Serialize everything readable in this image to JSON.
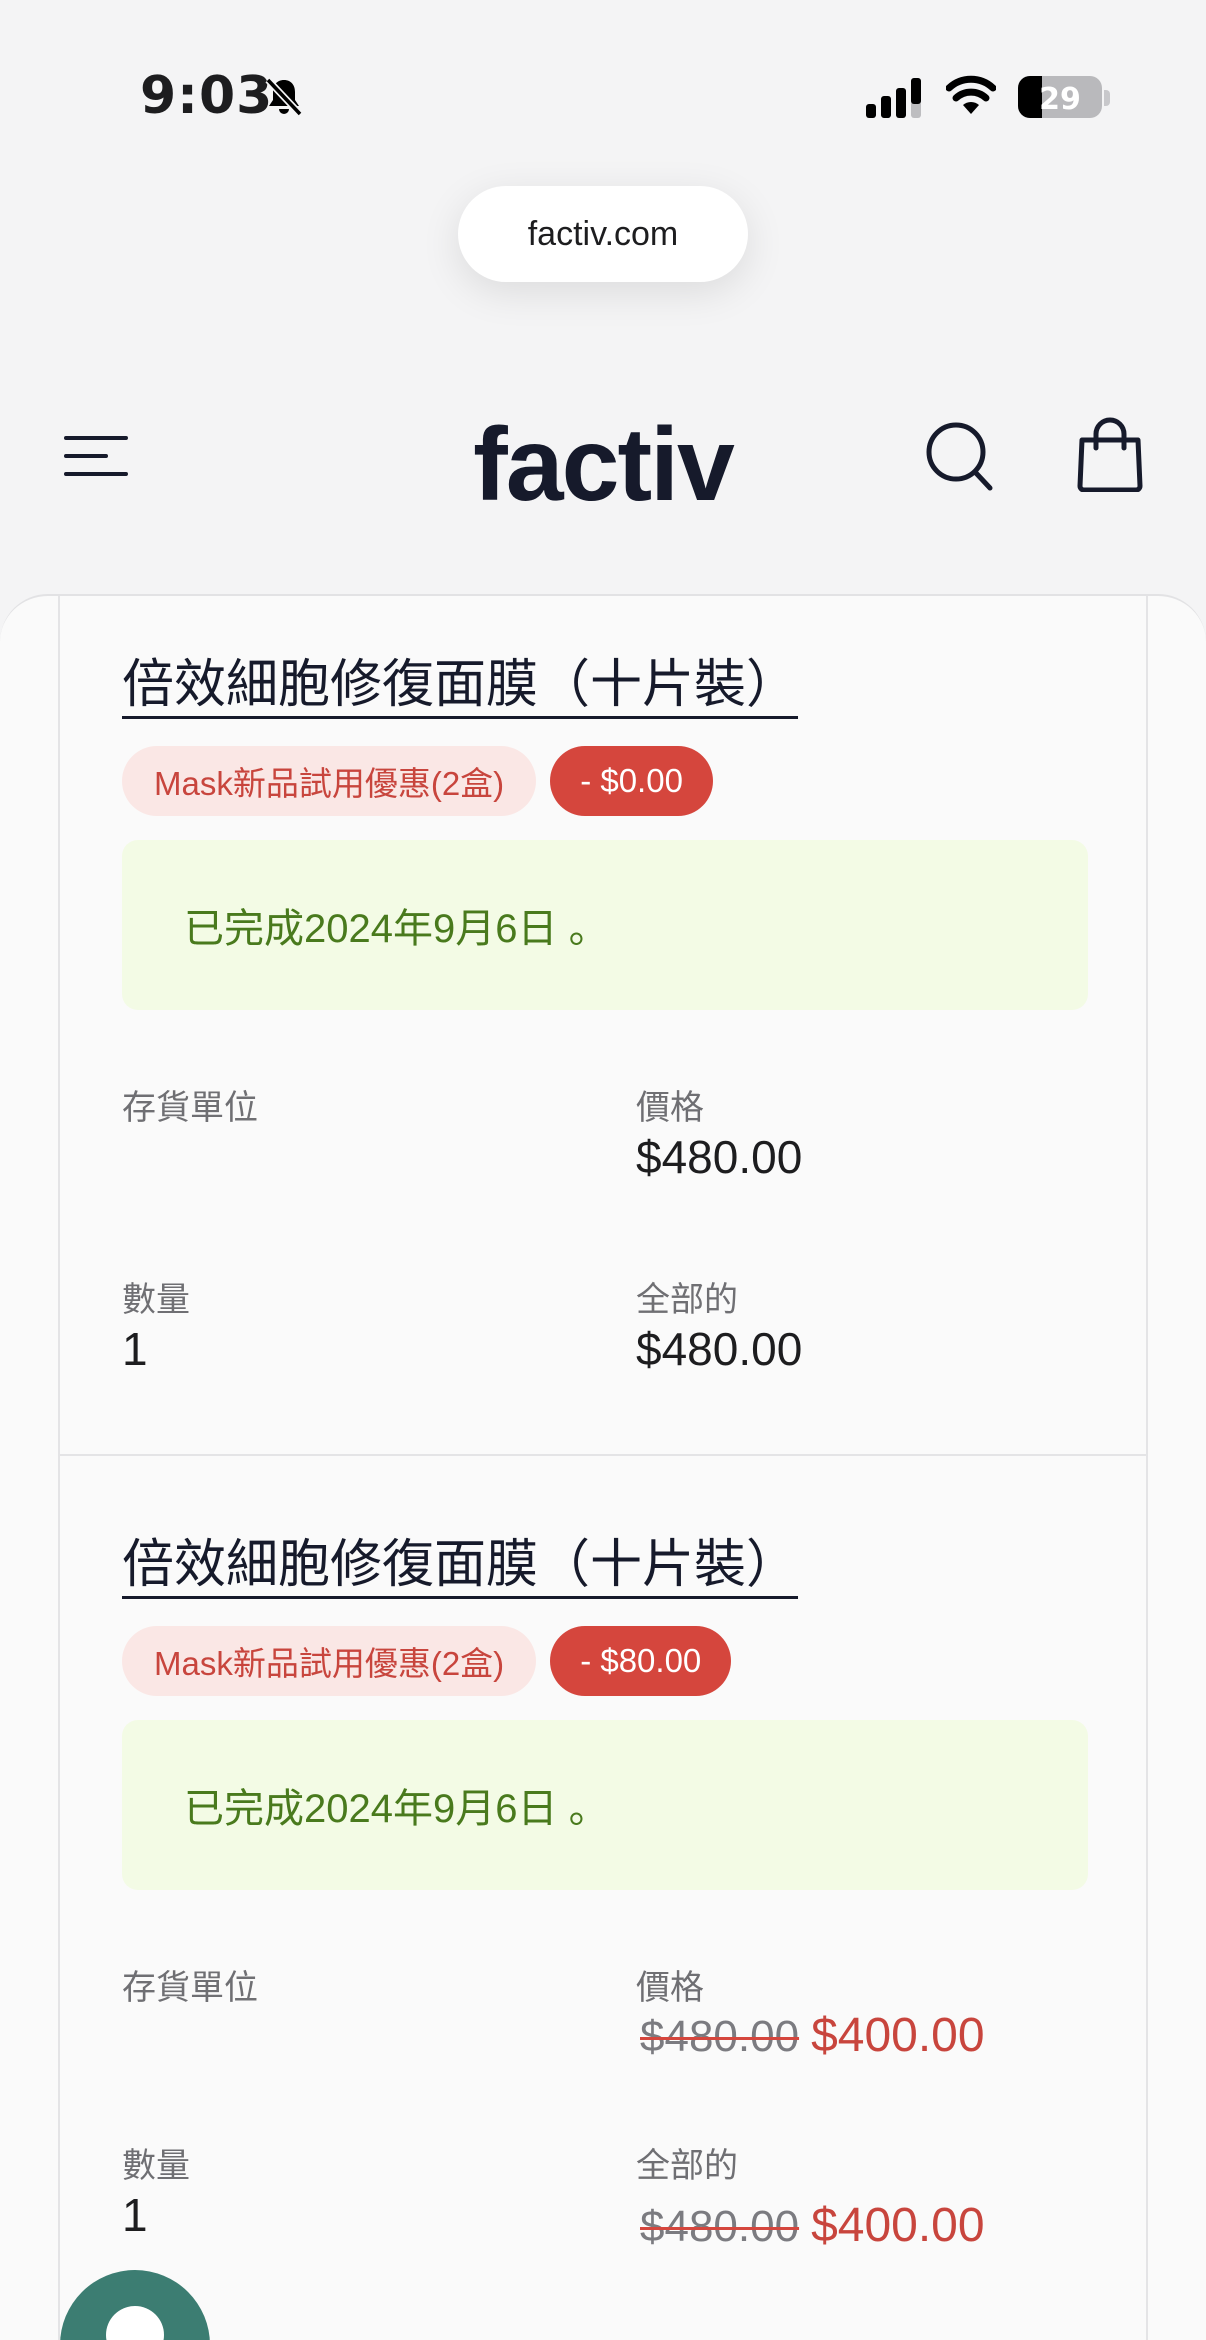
{
  "status_bar": {
    "time": "9:03",
    "battery": "29",
    "battery_level": 0.29
  },
  "browser": {
    "url": "factiv.com"
  },
  "header": {
    "logo": "factiv"
  },
  "orders": [
    {
      "title": "倍效細胞修復面膜（十片裝）",
      "promo_label": "Mask新品試用優惠(2盒)",
      "discount_label": "-  $0.00",
      "status": "已完成2024年9月6日 。",
      "sku_label": "存貨單位",
      "sku_value": "",
      "price_label": "價格",
      "price": "$480.00",
      "qty_label": "數量",
      "qty": "1",
      "total_label": "全部的",
      "total": "$480.00"
    },
    {
      "title": "倍效細胞修復面膜（十片裝）",
      "promo_label": "Mask新品試用優惠(2盒)",
      "discount_label": "-  $80.00",
      "status": "已完成2024年9月6日 。",
      "sku_label": "存貨單位",
      "sku_value": "",
      "price_label": "價格",
      "price_original": "$480.00",
      "price": "$400.00",
      "qty_label": "數量",
      "qty": "1",
      "total_label": "全部的",
      "total_original": "$480.00",
      "total": "$400.00"
    }
  ],
  "colors": {
    "accent_red": "#d5463d",
    "status_green_bg": "#f3fbe5",
    "status_green_text": "#497a1d",
    "chat_button": "#3c7d72"
  },
  "icons": [
    "bell-slash-icon",
    "signal-icon",
    "wifi-icon",
    "battery-icon",
    "menu-icon",
    "search-icon",
    "bag-icon",
    "chat-icon"
  ]
}
